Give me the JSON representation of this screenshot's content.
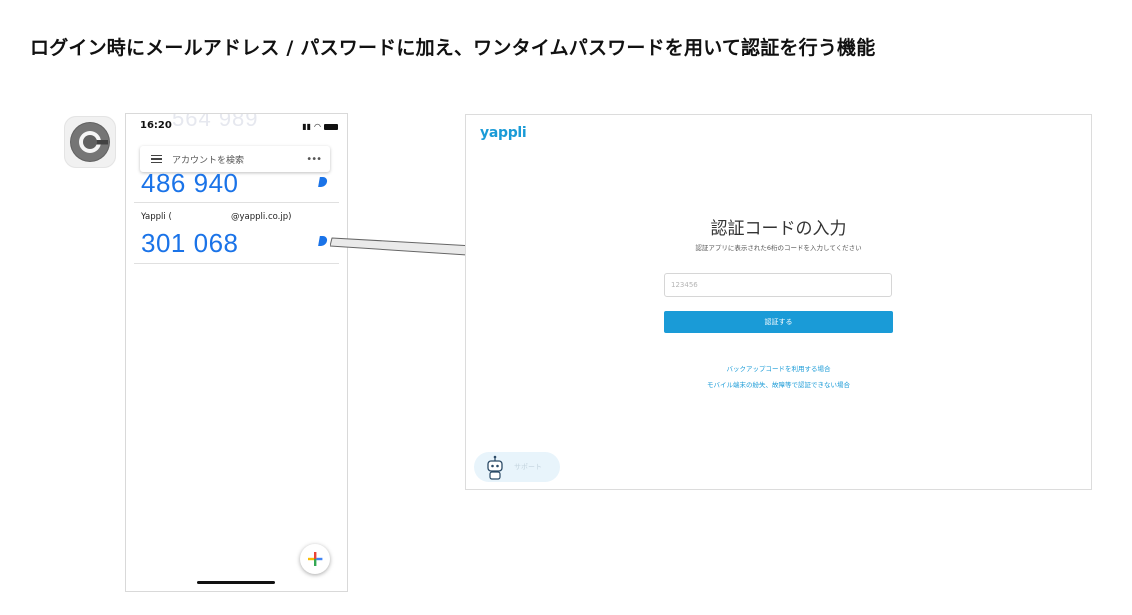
{
  "headline": "ログイン時にメールアドレス / パスワードに加え、ワンタイムパスワードを用いて認証を行う機能",
  "phone": {
    "status_time": "16:20",
    "ghost_code": "564 989",
    "search_placeholder": "アカウントを検索",
    "more_label": "•••",
    "entries": [
      {
        "code": "486 940"
      },
      {
        "account_name": "Yappli (",
        "account_email": "@yappli.co.jp)",
        "code": "301 068"
      }
    ]
  },
  "web": {
    "brand": "yappli",
    "title": "認証コードの入力",
    "subtitle": "認証アプリに表示された6桁のコードを入力してください",
    "input_placeholder": "123456",
    "verify_button": "認証する",
    "links": [
      "バックアップコードを利用する場合",
      "モバイル端末の紛失、故障等で認証できない場合"
    ],
    "support_label": "サポート"
  },
  "colors": {
    "accent_blue": "#1a9bd7",
    "code_blue": "#1a73e8",
    "google_red": "#ea4335",
    "google_yellow": "#fbbc05",
    "google_green": "#34a853"
  },
  "icons": [
    "google-authenticator-icon",
    "menu-icon",
    "more-icon",
    "timer-icon",
    "plus-icon",
    "arrow-icon",
    "support-robot-icon"
  ]
}
